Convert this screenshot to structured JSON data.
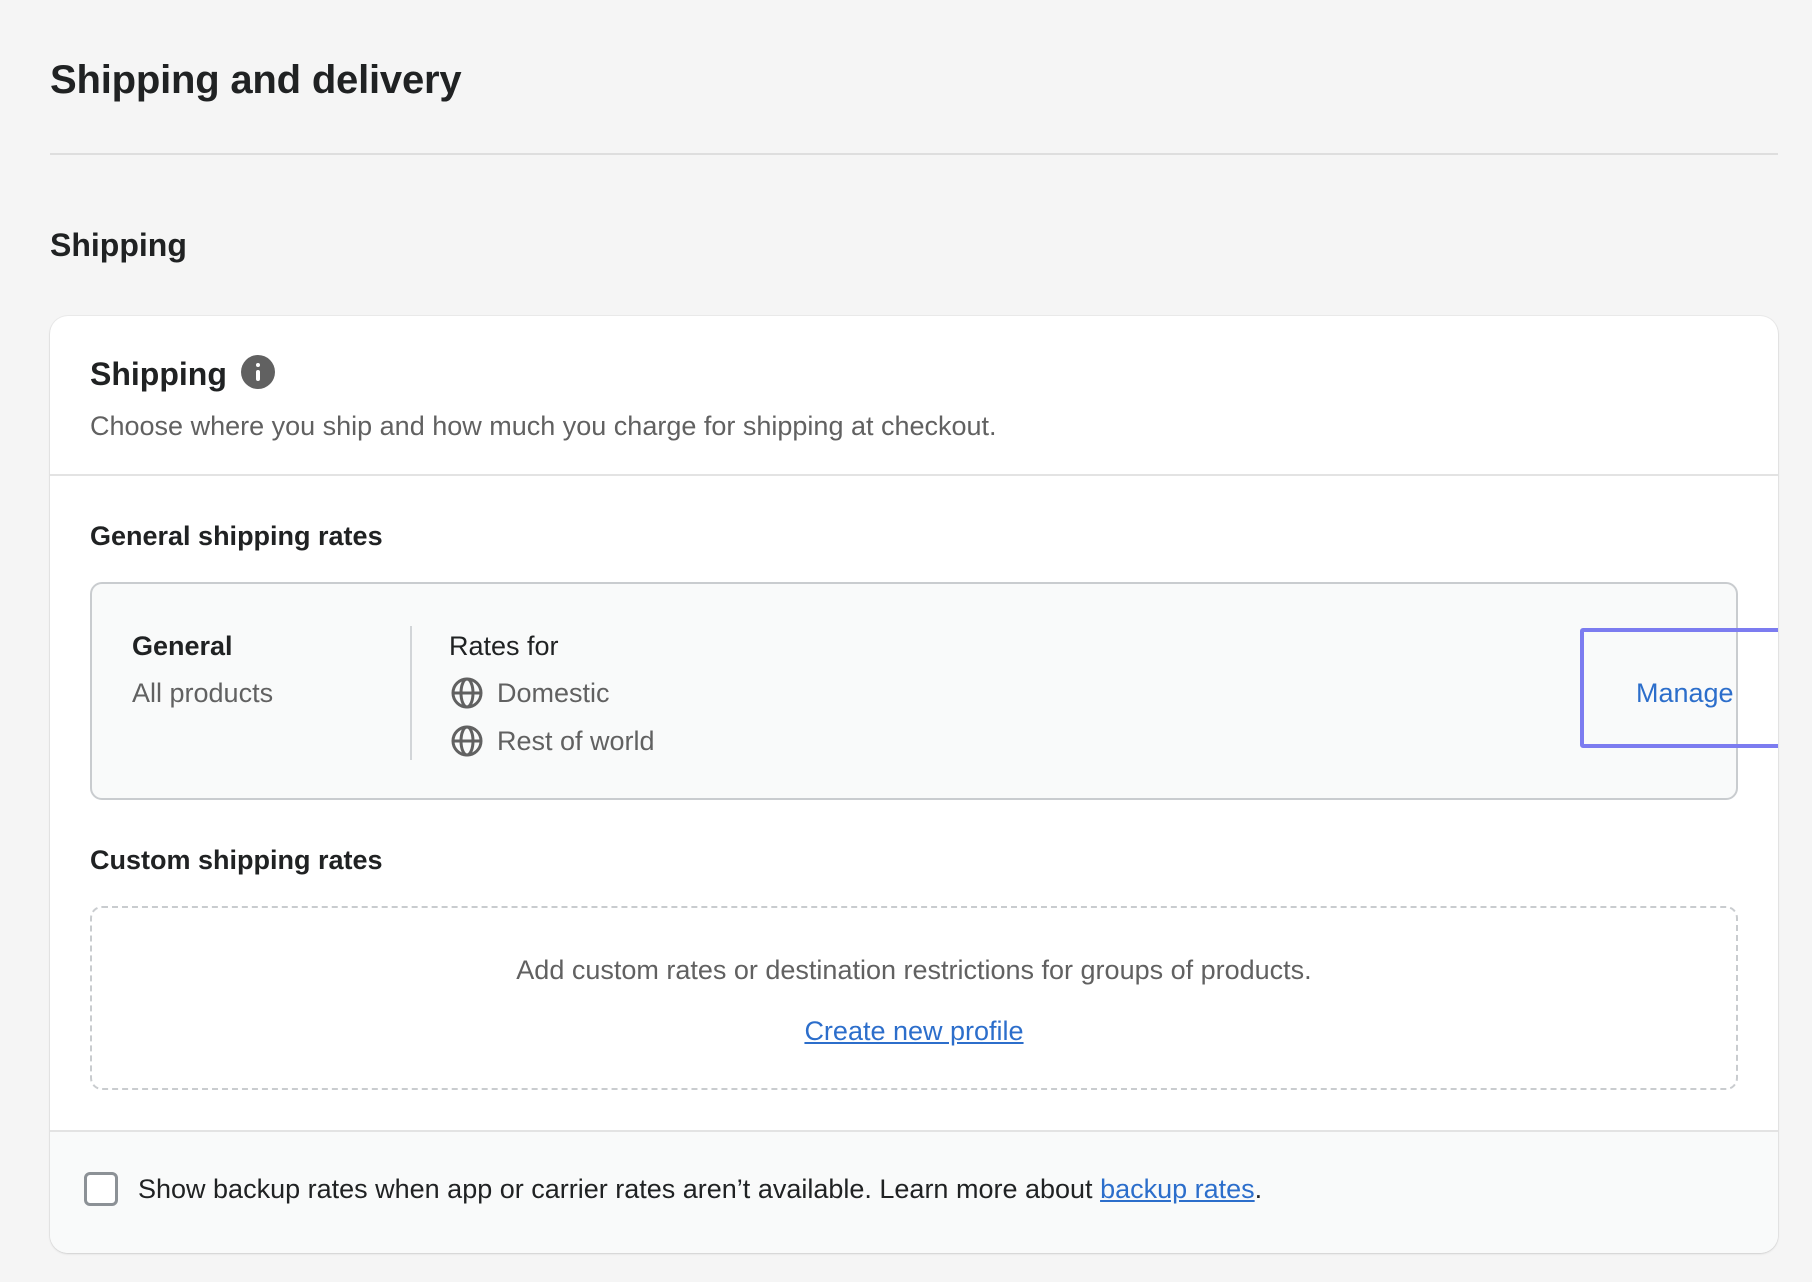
{
  "page": {
    "title": "Shipping and delivery",
    "section_heading": "Shipping"
  },
  "card": {
    "title": "Shipping",
    "info_icon": "info-icon",
    "subtitle": "Choose where you ship and how much you charge for shipping at checkout."
  },
  "general_rates": {
    "heading": "General shipping rates",
    "profile_name": "General",
    "profile_scope": "All products",
    "rates_for_label": "Rates for",
    "zones": [
      {
        "label": "Domestic",
        "icon": "globe-icon"
      },
      {
        "label": "Rest of world",
        "icon": "globe-icon"
      }
    ],
    "manage_label": "Manage"
  },
  "custom_rates": {
    "heading": "Custom shipping rates",
    "description": "Add custom rates or destination restrictions for groups of products.",
    "create_link": "Create new profile"
  },
  "footer": {
    "checkbox_checked": false,
    "text_before": "Show backup rates when app or carrier rates aren’t available. Learn more about",
    "link_text": "backup rates",
    "text_after": "."
  },
  "colors": {
    "link": "#2c6ecb",
    "highlight": "#7c7cf0",
    "background": "#f5f5f5"
  }
}
